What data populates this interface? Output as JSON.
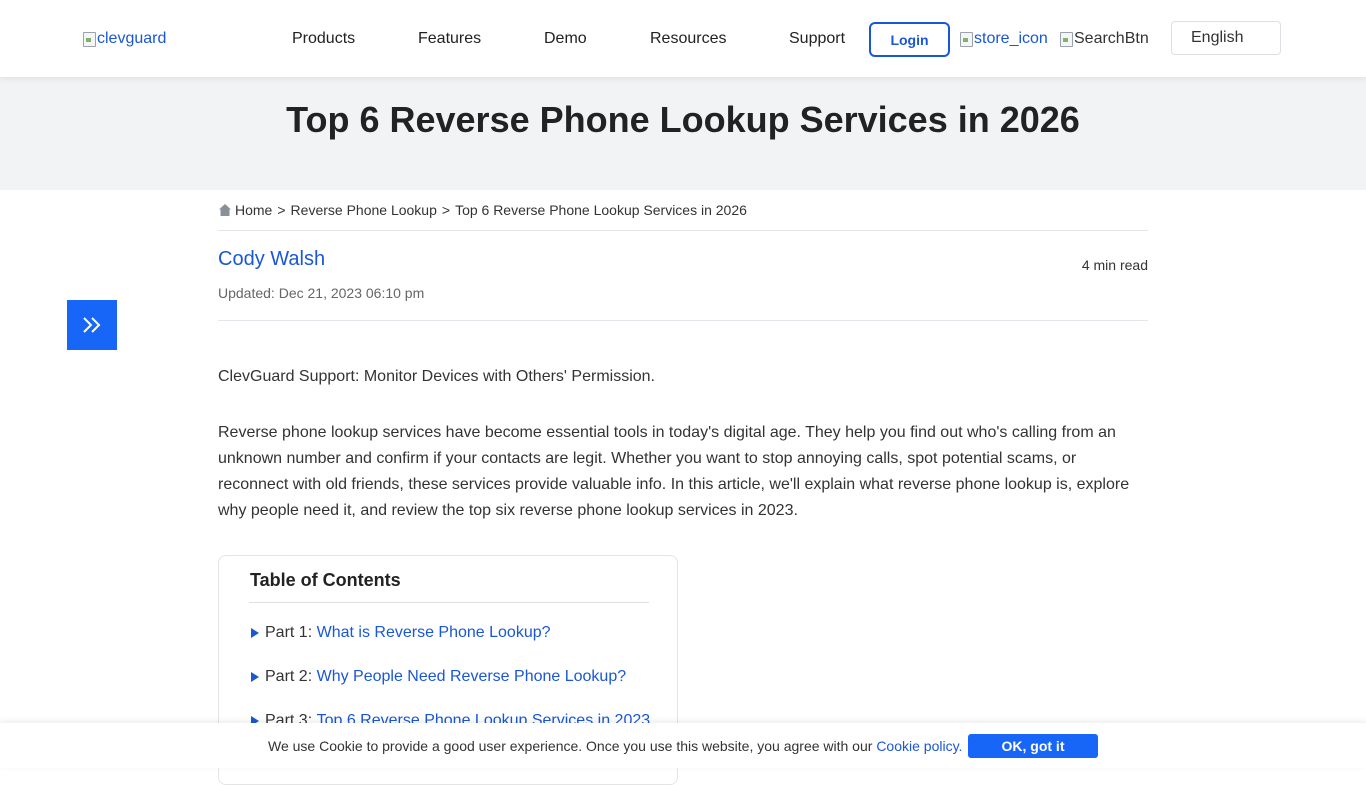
{
  "header": {
    "logo_alt": "clevguard",
    "nav": [
      "Products",
      "Features",
      "Demo",
      "Resources",
      "Support"
    ],
    "login_label": "Login",
    "store_icon_alt": "store_icon",
    "search_alt": "SearchBtn",
    "language": "English"
  },
  "hero": {
    "title": "Top 6 Reverse Phone Lookup Services in 2026"
  },
  "breadcrumb": {
    "home": "Home",
    "sep": ">",
    "category": "Reverse Phone Lookup",
    "current": "Top 6 Reverse Phone Lookup Services in 2026"
  },
  "article": {
    "author": "Cody Walsh",
    "read_time": "4 min read",
    "updated": "Updated: Dec 21, 2023 06:10 pm",
    "support_note": "ClevGuard Support: Monitor Devices with Others' Permission.",
    "intro": "Reverse phone lookup services have become essential tools in today's digital age. They help you find out who's calling from an unknown number and confirm if your contacts are legit. Whether you want to stop annoying calls, spot potential scams, or reconnect with old friends, these services provide valuable info. In this article, we'll explain what reverse phone lookup is, explore why people need it, and review the top six reverse phone lookup services in 2023."
  },
  "toc": {
    "title": "Table of Contents",
    "items": [
      {
        "part": "Part 1:",
        "label": "What is Reverse Phone Lookup?"
      },
      {
        "part": "Part 2:",
        "label": "Why People Need Reverse Phone Lookup?"
      },
      {
        "part": "Part 3:",
        "label": "Top 6 Reverse Phone Lookup Services in 2023"
      }
    ]
  },
  "cookie": {
    "text": "We use Cookie to provide a good user experience. Once you use this website, you agree with our",
    "link": "Cookie policy.",
    "button": "OK, got it"
  },
  "colors": {
    "accent": "#1766f7",
    "link": "#1a57d6",
    "hero_bg": "#f1f3f5"
  }
}
